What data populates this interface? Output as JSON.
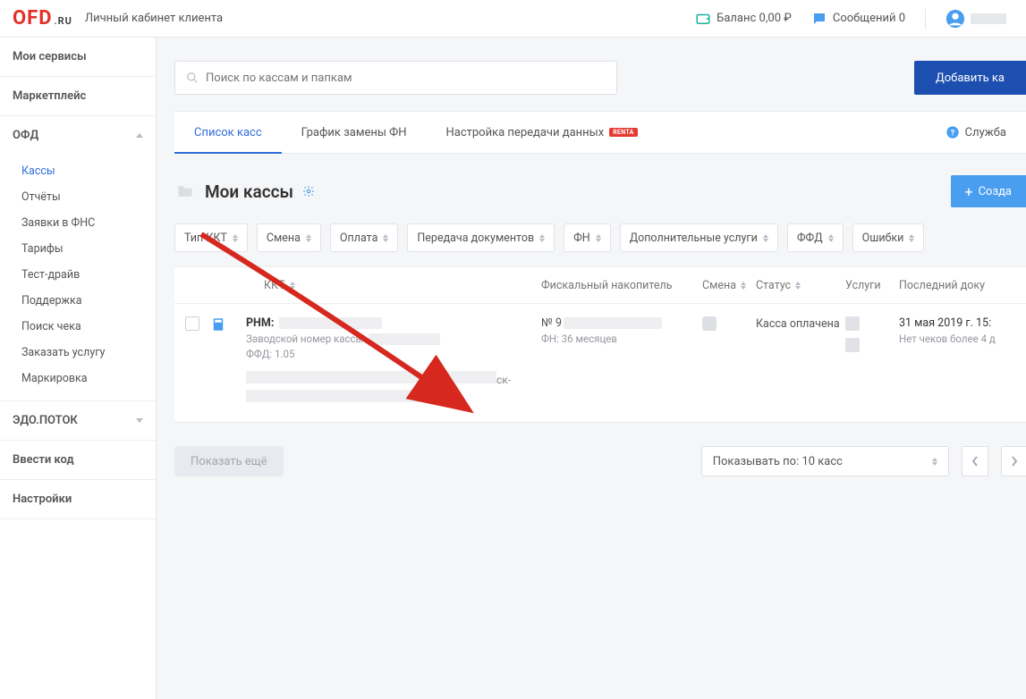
{
  "header": {
    "logo_main": "OFD",
    "logo_ru": ".RU",
    "subtitle": "Личный кабинет клиента",
    "balance_label": "Баланс 0,00 ₽",
    "messages_label": "Сообщений 0"
  },
  "sidebar": {
    "s0": "Мои сервисы",
    "s1": "Маркетплейс",
    "s2": "ОФД",
    "s2_items": [
      "Кассы",
      "Отчёты",
      "Заявки в ФНС",
      "Тарифы",
      "Тест-драйв",
      "Поддержка",
      "Поиск чека",
      "Заказать услугу",
      "Маркировка"
    ],
    "s3": "ЭДО.ПОТОК",
    "s4": "Ввести код",
    "s5": "Настройки"
  },
  "search": {
    "placeholder": "Поиск по кассам и папкам"
  },
  "buttons": {
    "add_cash": "Добавить ка",
    "create": "Созда",
    "show_more": "Показать ещё"
  },
  "tabs": {
    "t0": "Список касс",
    "t1": "График замены ФН",
    "t2": "Настройка передачи данных",
    "badge": "RENTA",
    "help": "Служба"
  },
  "section": {
    "title": "Мои кассы"
  },
  "filters": [
    "Тип ККТ",
    "Смена",
    "Оплата",
    "Передача документов",
    "ФН",
    "Дополнительные услуги",
    "ФФД",
    "Ошибки"
  ],
  "thead": {
    "kkt": "ККТ",
    "fn": "Фискальный накопитель",
    "shift": "Смена",
    "status": "Статус",
    "services": "Услуги",
    "lastdoc": "Последний доку"
  },
  "row": {
    "rnm_label": "РНМ:",
    "serial_label": "Заводской номер кассы:",
    "ffd_line": "ФФД: 1.05",
    "fn_no": "№ 9",
    "fn_term": "ФН: 36 месяцев",
    "status": "Касса оплачена",
    "last_date": "31 мая 2019 г. 15:",
    "last_note": "Нет чеков более 4 д"
  },
  "pager": {
    "label": "Показывать по: 10 касс"
  }
}
